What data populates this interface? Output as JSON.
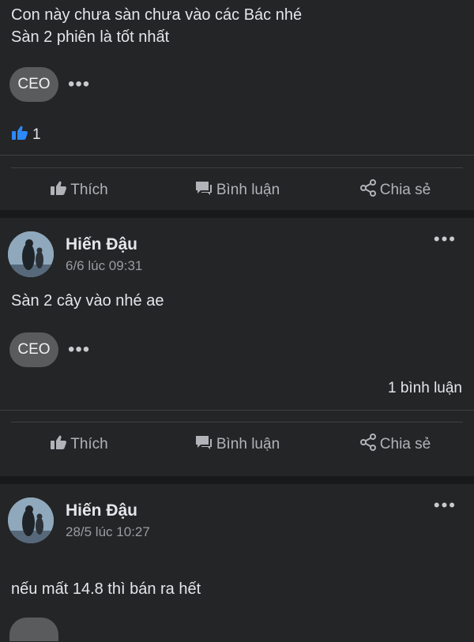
{
  "post1": {
    "text_line1": "Con này chưa sàn chưa vào các Bác nhé",
    "text_line2": "Sàn 2 phiên là tốt nhất",
    "chip_label": "CEO",
    "like_count": "1"
  },
  "post2": {
    "author": "Hiến Đậu",
    "time": "6/6 lúc 09:31",
    "text": "Sàn 2 cây vào nhé ae",
    "chip_label": "CEO",
    "comment_count": "1 bình luận"
  },
  "post3": {
    "author": "Hiến Đậu",
    "time": "28/5 lúc 10:27",
    "text": "nếu mất 14.8 thì bán ra hết"
  },
  "actions": {
    "like": "Thích",
    "comment": "Bình luận",
    "share": "Chia sẻ"
  },
  "colors": {
    "background": "#18191a",
    "card": "#242526",
    "like_blue": "#2d88ff"
  }
}
